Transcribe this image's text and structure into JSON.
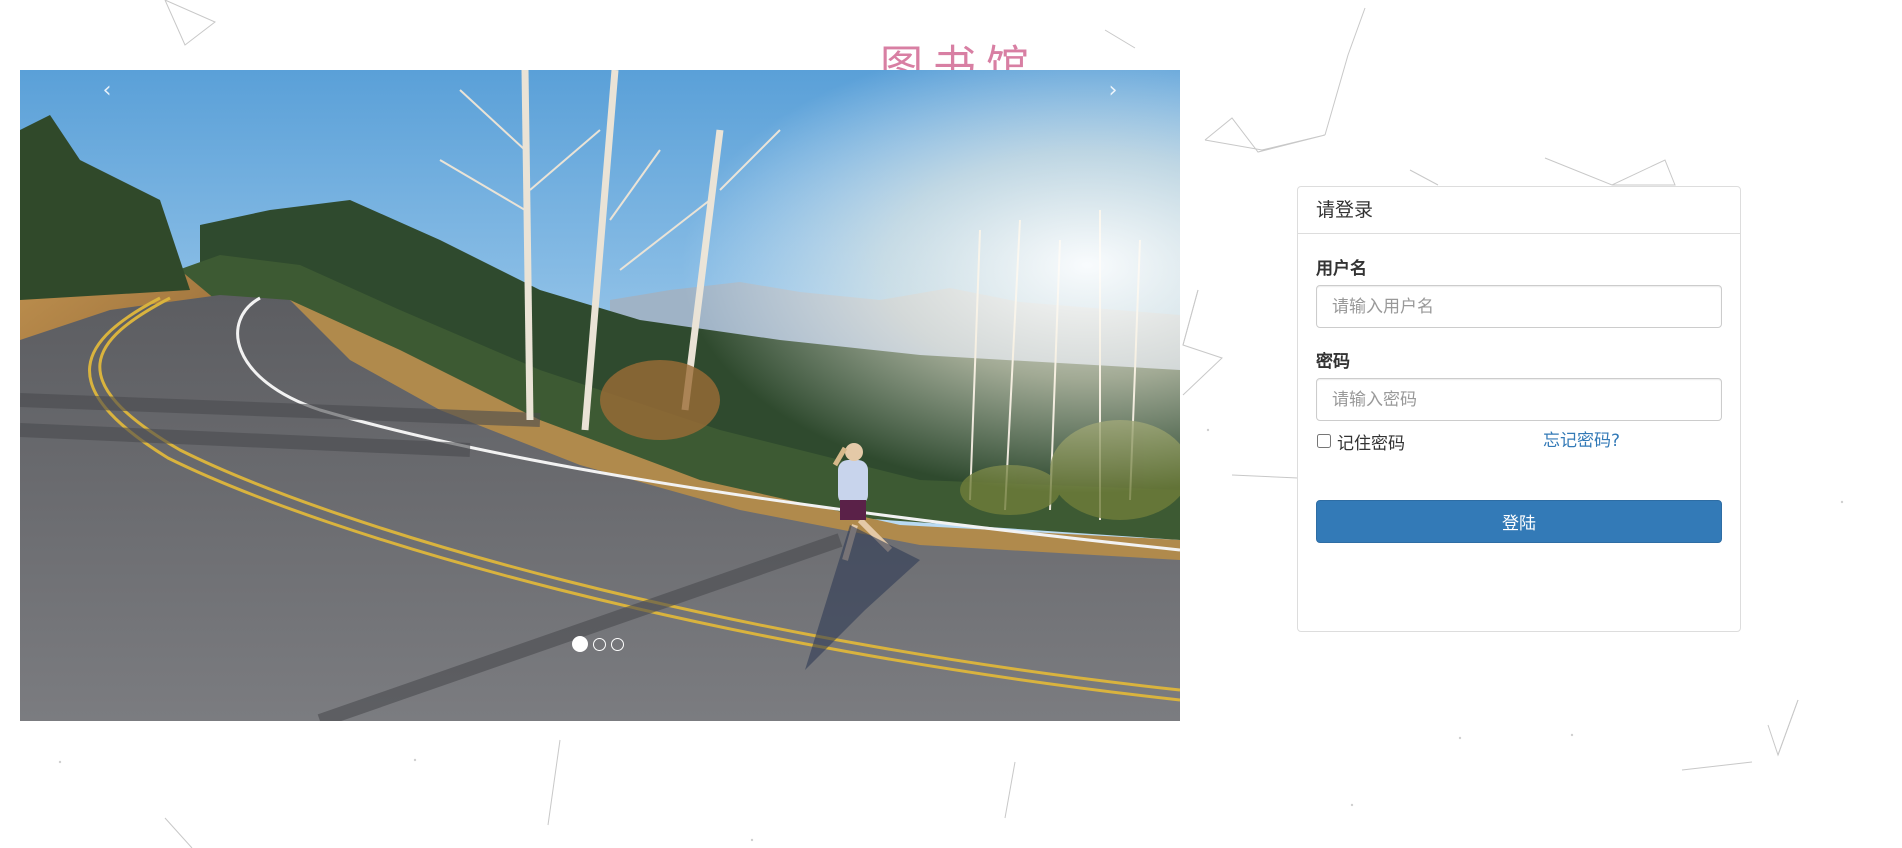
{
  "site": {
    "title": "图书馆"
  },
  "carousel": {
    "prev_label": "‹",
    "next_label": "›",
    "slide_count": 3,
    "active_slide": 1
  },
  "login": {
    "heading": "请登录",
    "username_label": "用户名",
    "username_placeholder": "请输入用户名",
    "username_value": "",
    "password_label": "密码",
    "password_placeholder": "请输入密码",
    "password_value": "",
    "remember_label": "记住密码",
    "remember_checked": false,
    "forgot_label": "忘记密码?",
    "submit_label": "登陆"
  },
  "colors": {
    "title": "#d87fa3",
    "primary": "#337ab7",
    "link": "#337ab7",
    "panel_border": "#dddddd"
  }
}
